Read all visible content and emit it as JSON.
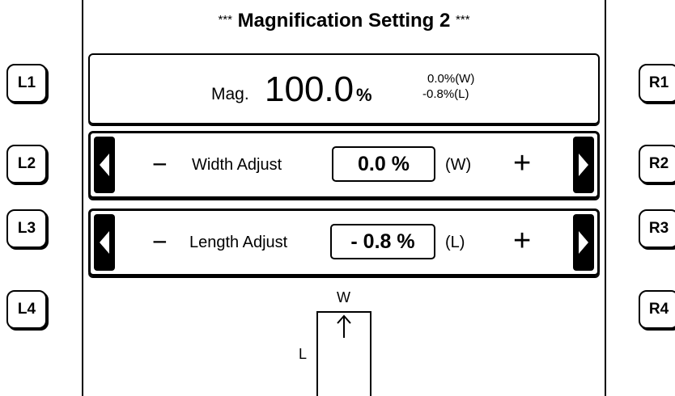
{
  "title": {
    "stars_left": "***",
    "text": "Magnification Setting 2",
    "stars_right": "***"
  },
  "side_buttons": {
    "left": [
      "L1",
      "L2",
      "L3",
      "L4"
    ],
    "right": [
      "R1",
      "R2",
      "R3",
      "R4"
    ]
  },
  "magnification": {
    "label": "Mag.",
    "value": "100.0",
    "unit": "%",
    "width_detail": "0.0%(W)",
    "length_detail": "-0.8%(L)"
  },
  "width_adjust": {
    "minus": "−",
    "label": "Width Adjust",
    "value": "0.0 %",
    "axis": "(W)",
    "plus": "+"
  },
  "length_adjust": {
    "minus": "−",
    "label": "Length Adjust",
    "value": "- 0.8 %",
    "axis": "(L)",
    "plus": "+"
  },
  "diagram": {
    "w_label": "W",
    "l_label": "L"
  },
  "icons": {
    "arrow_left": "left-arrow-icon",
    "arrow_right": "right-arrow-icon",
    "up_arrow": "up-arrow-icon"
  }
}
